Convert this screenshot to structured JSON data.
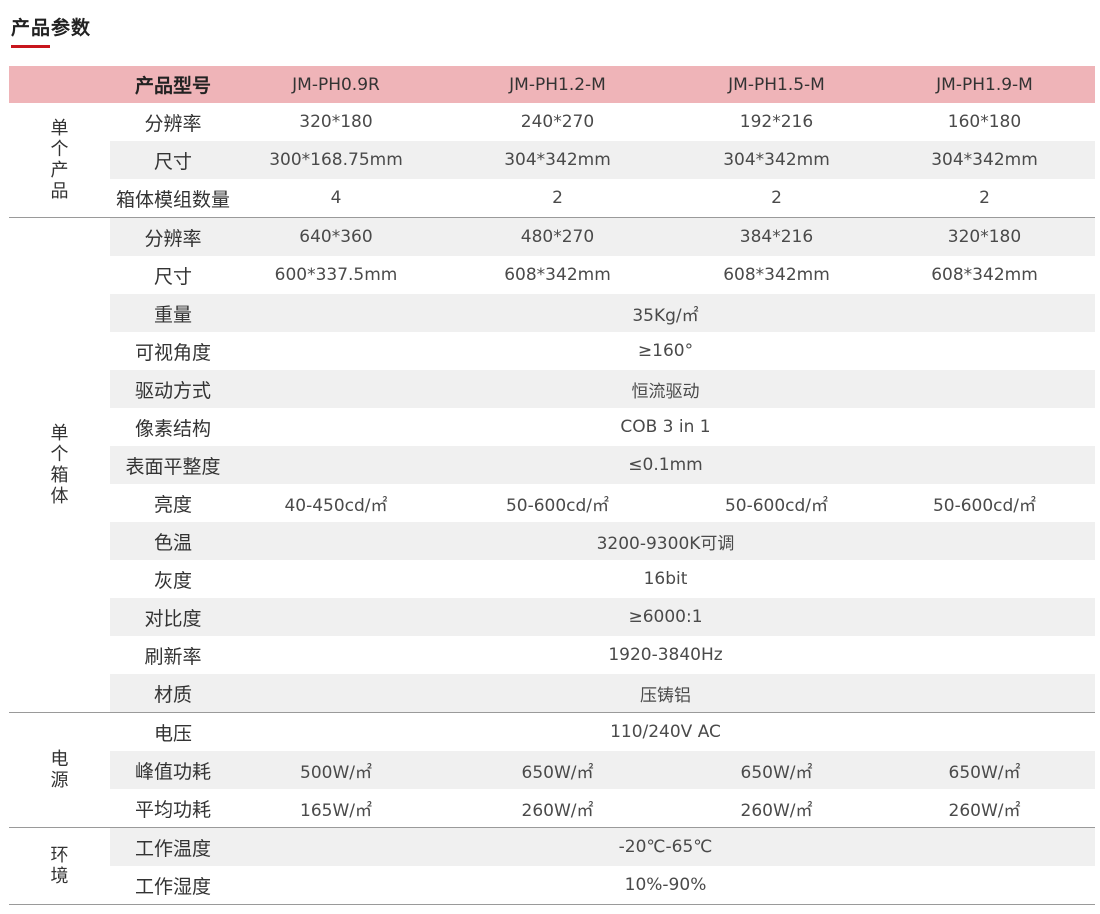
{
  "page": {
    "title": "产品参数"
  },
  "table": {
    "corner_label": "产品型号",
    "models": [
      "JM-PH0.9R",
      "JM-PH1.2-M",
      "JM-PH1.5-M",
      "JM-PH1.9-M"
    ],
    "groups": [
      {
        "label": "单个产品",
        "rows": [
          {
            "label": "分辨率",
            "values": [
              "320*180",
              "240*270",
              "192*216",
              "160*180"
            ]
          },
          {
            "label": "尺寸",
            "values": [
              "300*168.75mm",
              "304*342mm",
              "304*342mm",
              "304*342mm"
            ]
          },
          {
            "label": "箱体模组数量",
            "values": [
              "4",
              "2",
              "2",
              "2"
            ]
          }
        ]
      },
      {
        "label": "单个箱体",
        "rows": [
          {
            "label": "分辨率",
            "values": [
              "640*360",
              "480*270",
              "384*216",
              "320*180"
            ]
          },
          {
            "label": "尺寸",
            "values": [
              "600*337.5mm",
              "608*342mm",
              "608*342mm",
              "608*342mm"
            ]
          },
          {
            "label": "重量",
            "span_value": "35Kg/㎡"
          },
          {
            "label": "可视角度",
            "span_value": "≥160°"
          },
          {
            "label": "驱动方式",
            "span_value": "恒流驱动"
          },
          {
            "label": "像素结构",
            "span_value": "COB 3 in 1"
          },
          {
            "label": "表面平整度",
            "span_value": "≤0.1mm"
          },
          {
            "label": "亮度",
            "values": [
              "40-450cd/㎡",
              "50-600cd/㎡",
              "50-600cd/㎡",
              "50-600cd/㎡"
            ]
          },
          {
            "label": "色温",
            "span_value": "3200-9300K可调"
          },
          {
            "label": "灰度",
            "span_value": "16bit"
          },
          {
            "label": "对比度",
            "span_value": "≥6000:1"
          },
          {
            "label": "刷新率",
            "span_value": "1920-3840Hz"
          },
          {
            "label": "材质",
            "span_value": "压铸铝"
          }
        ]
      },
      {
        "label": "电源",
        "rows": [
          {
            "label": "电压",
            "span_value": "110/240V  AC"
          },
          {
            "label": "峰值功耗",
            "values": [
              "500W/㎡",
              "650W/㎡",
              "650W/㎡",
              "650W/㎡"
            ]
          },
          {
            "label": "平均功耗",
            "values": [
              "165W/㎡",
              "260W/㎡",
              "260W/㎡",
              "260W/㎡"
            ]
          }
        ]
      },
      {
        "label": "环境",
        "rows": [
          {
            "label": "工作温度",
            "span_value": "-20℃-65℃"
          },
          {
            "label": "工作湿度",
            "span_value": "10%-90%"
          }
        ]
      }
    ]
  }
}
